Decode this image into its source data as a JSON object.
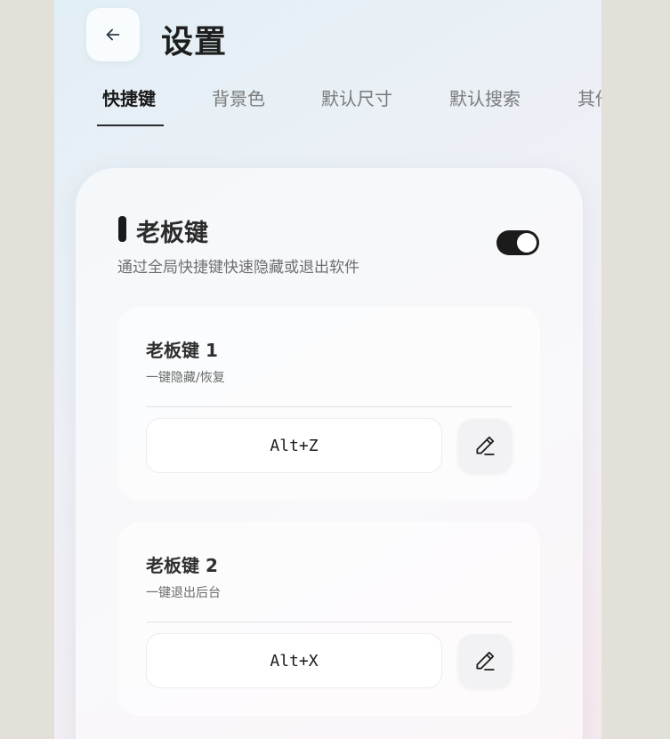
{
  "header": {
    "title": "设置",
    "back_icon": "arrow-left-icon"
  },
  "tabs": [
    {
      "label": "快捷键",
      "active": true
    },
    {
      "label": "背景色",
      "active": false
    },
    {
      "label": "默认尺寸",
      "active": false
    },
    {
      "label": "默认搜索",
      "active": false
    },
    {
      "label": "其他",
      "active": false
    }
  ],
  "boss_key_section": {
    "title": "老板键",
    "description": "通过全局快捷键快速隐藏或退出软件",
    "enabled": true,
    "keys": [
      {
        "name": "老板键 1",
        "description": "一键隐藏/恢复",
        "shortcut": "Alt+Z",
        "edit_icon": "pencil-icon"
      },
      {
        "name": "老板键 2",
        "description": "一键退出后台",
        "shortcut": "Alt+X",
        "edit_icon": "pencil-icon"
      }
    ]
  },
  "colors": {
    "accent": "#1b1b1b",
    "text_primary": "#1e1e1e",
    "text_secondary": "#6e6e6e",
    "outer_background": "#e3e0da"
  }
}
